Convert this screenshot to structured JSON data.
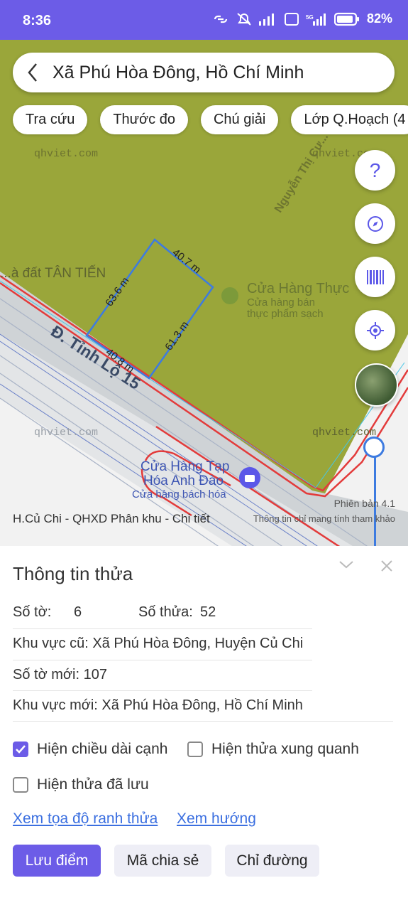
{
  "status": {
    "time": "8:36",
    "battery": "82%"
  },
  "search": {
    "title": "Xã Phú Hòa Đông, Hồ Chí Minh"
  },
  "chips": [
    "Tra cứu",
    "Thước đo",
    "Chú giải",
    "Lớp Q.Hoạch (4"
  ],
  "map": {
    "watermarks": [
      "qhviet.com",
      "qhviet.com",
      "qhviet.com",
      "qhviet.com"
    ],
    "road_label": "Đ. Tỉnh Lộ 15",
    "road_label_2": "Nguyễn Thị Cư...",
    "place_tan_tien": "...à đất TÂN TIẾN",
    "shop_food_name": "Cửa Hàng Thực",
    "shop_food_sub1": "Cửa hàng bán",
    "shop_food_sub2": "thực phẩm sạch",
    "shop_tap_name1": "Cửa Hàng Tạp",
    "shop_tap_name2": "Hóa Anh Đào",
    "shop_tap_sub": "Cửa hàng bách hóa",
    "edge_labels": [
      "40.7 m",
      "63.6 m",
      "61.3 m",
      "40.8 m"
    ],
    "version": "Phiên bản 4.1",
    "plan_label": "H.Củ Chi - QHXD Phân khu - Chi tiết",
    "disclaimer": "Thông tin chỉ mang tính tham khảo"
  },
  "panel": {
    "title": "Thông tin thửa",
    "so_to_label": "Số tờ:",
    "so_to_value": "6",
    "so_thua_label": "Số thửa:",
    "so_thua_value": "52",
    "khu_vuc_cu": "Khu vực cũ: Xã Phú Hòa Đông, Huyện Củ Chi",
    "so_to_moi": "Số tờ mới: 107",
    "khu_vuc_moi": "Khu vực mới: Xã Phú Hòa Đông, Hồ Chí Minh",
    "checkboxes": [
      {
        "label": "Hiện chiều dài cạnh",
        "checked": true
      },
      {
        "label": "Hiện thửa xung quanh",
        "checked": false
      },
      {
        "label": "Hiện thửa đã lưu",
        "checked": false
      }
    ],
    "links": [
      "Xem tọa độ ranh thửa",
      "Xem hướng"
    ],
    "buttons": [
      "Lưu điểm",
      "Mã chia sẻ",
      "Chỉ đường"
    ]
  },
  "colors": {
    "accent": "#6c5ce7",
    "parcel_fill": "#9aa63a",
    "boundary_red": "#e33b3b",
    "parcel_blue": "#3d7be0"
  }
}
